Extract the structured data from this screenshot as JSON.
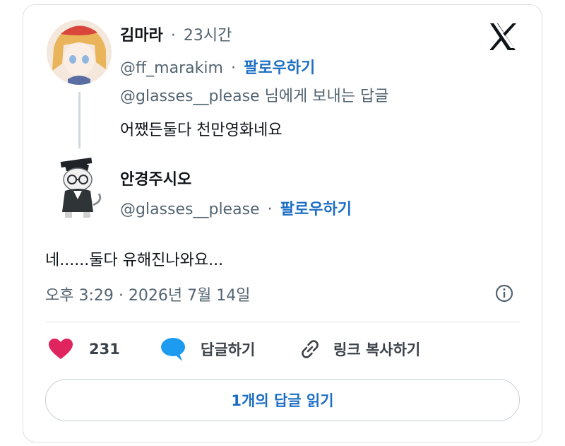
{
  "colors": {
    "accent": "#1d6fc4",
    "like": "#e0245e",
    "reply_bubble": "#1d9bf0",
    "muted": "#536471"
  },
  "parent": {
    "author_name": "김마라",
    "time_ago": "23시간",
    "handle": "@ff_marakim",
    "follow_label": "팔로우하기",
    "reply_to": "@glasses__please 님에게 보내는 답글",
    "text": "어쨌든둘다 천만영화네요"
  },
  "reply": {
    "author_name": "안경주시오",
    "handle": "@glasses__please",
    "follow_label": "팔로우하기",
    "text": "네......둘다 유해진나와요...",
    "timestamp": "오후 3:29 · 2026년 7월 14일"
  },
  "actions": {
    "like_count": "231",
    "reply_label": "답글하기",
    "copy_link_label": "링크 복사하기"
  },
  "read_replies_label": "1개의 답글 읽기",
  "separator": "·",
  "icons": {
    "brand": "x-logo-icon",
    "info": "info-icon",
    "like": "heart-icon",
    "reply": "speech-bubble-icon",
    "link": "link-icon"
  }
}
